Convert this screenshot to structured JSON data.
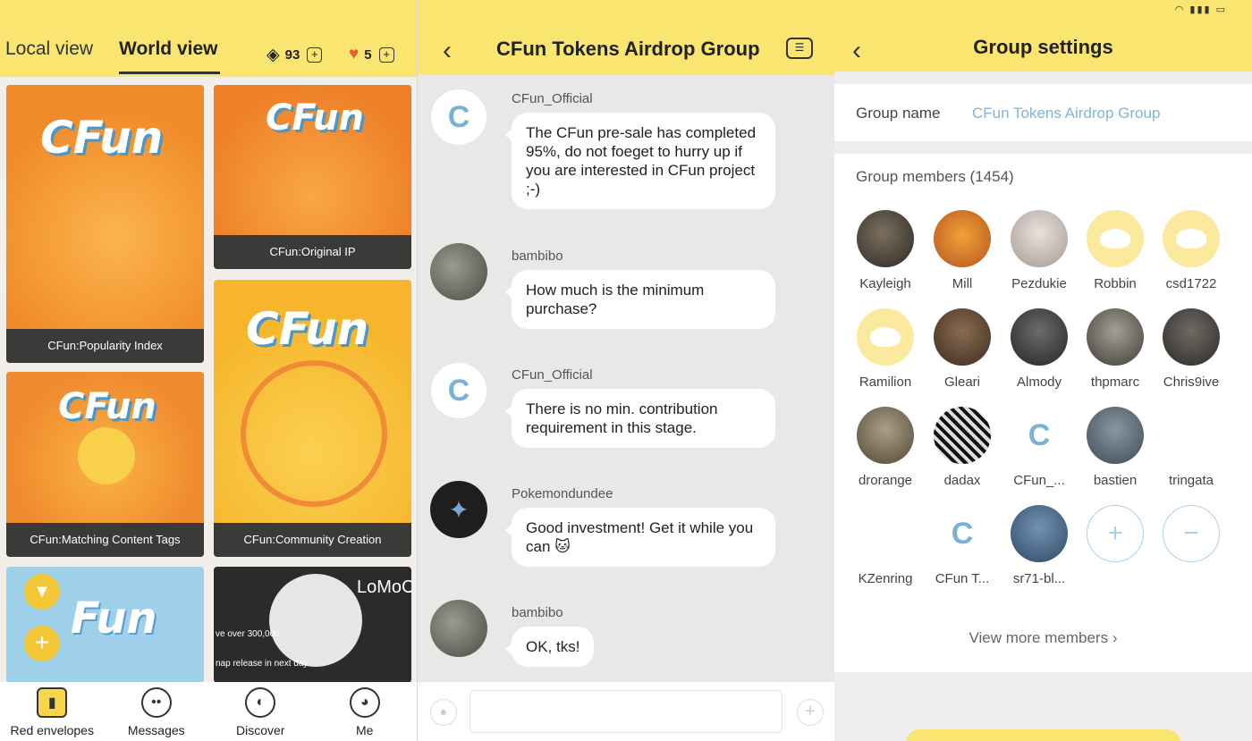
{
  "panel1": {
    "tabs": {
      "local": "Local view",
      "world": "World view"
    },
    "gems": {
      "icon": "diamond-icon",
      "count": "93"
    },
    "hearts": {
      "icon": "heart-icon",
      "count": "5"
    },
    "cards": [
      {
        "logo": "CFun",
        "caption": "CFun:Popularity Index"
      },
      {
        "logo": "CFun",
        "caption": "CFun:Original IP"
      },
      {
        "logo": "CFun",
        "caption": "CFun:Matching Content Tags"
      },
      {
        "logo": "CFun",
        "caption": "CFun:Community Creation"
      },
      {
        "logo": "Fun",
        "caption": ""
      },
      {
        "logo": "LoMoC",
        "caption": ""
      }
    ],
    "card6_text": {
      "line1": "ve over 300,000",
      "line2": "nap release in next day"
    },
    "nav": [
      {
        "label": "Red envelopes",
        "icon": "red-envelope-icon"
      },
      {
        "label": "Messages",
        "icon": "messages-icon"
      },
      {
        "label": "Discover",
        "icon": "discover-icon"
      },
      {
        "label": "Me",
        "icon": "me-icon"
      }
    ]
  },
  "panel2": {
    "title": "CFun Tokens Airdrop Group",
    "messages": [
      {
        "sender": "CFun_Official",
        "text": "The CFun pre-sale has completed 95%, do not foeget to hurry up if you are interested in CFun project ;-)"
      },
      {
        "sender": "bambibo",
        "text": "How much is the minimum purchase?"
      },
      {
        "sender": "CFun_Official",
        "text": "There is no min. contribution requirement in this stage."
      },
      {
        "sender": "Pokemondundee",
        "text": "Good investment! Get it while you can 🐱"
      },
      {
        "sender": "bambibo",
        "text": "OK, tks!"
      }
    ]
  },
  "panel3": {
    "title": "Group settings",
    "group_name_label": "Group name",
    "group_name_value": "CFun Tokens Airdrop Group",
    "members_title": "Group members (1454)",
    "members": [
      "Kayleigh",
      "Mill",
      "Pezdukie",
      "Robbin",
      "csd1722",
      "Ramilion",
      "Gleari",
      "Almody",
      "thpmarc",
      "Chris9ive",
      "drorange",
      "dadax",
      "CFun_...",
      "bastien",
      "tringata",
      "KZenring",
      "CFun T...",
      "sr71-bl..."
    ],
    "view_more": "View more members",
    "add_icon": "+",
    "remove_icon": "−"
  }
}
